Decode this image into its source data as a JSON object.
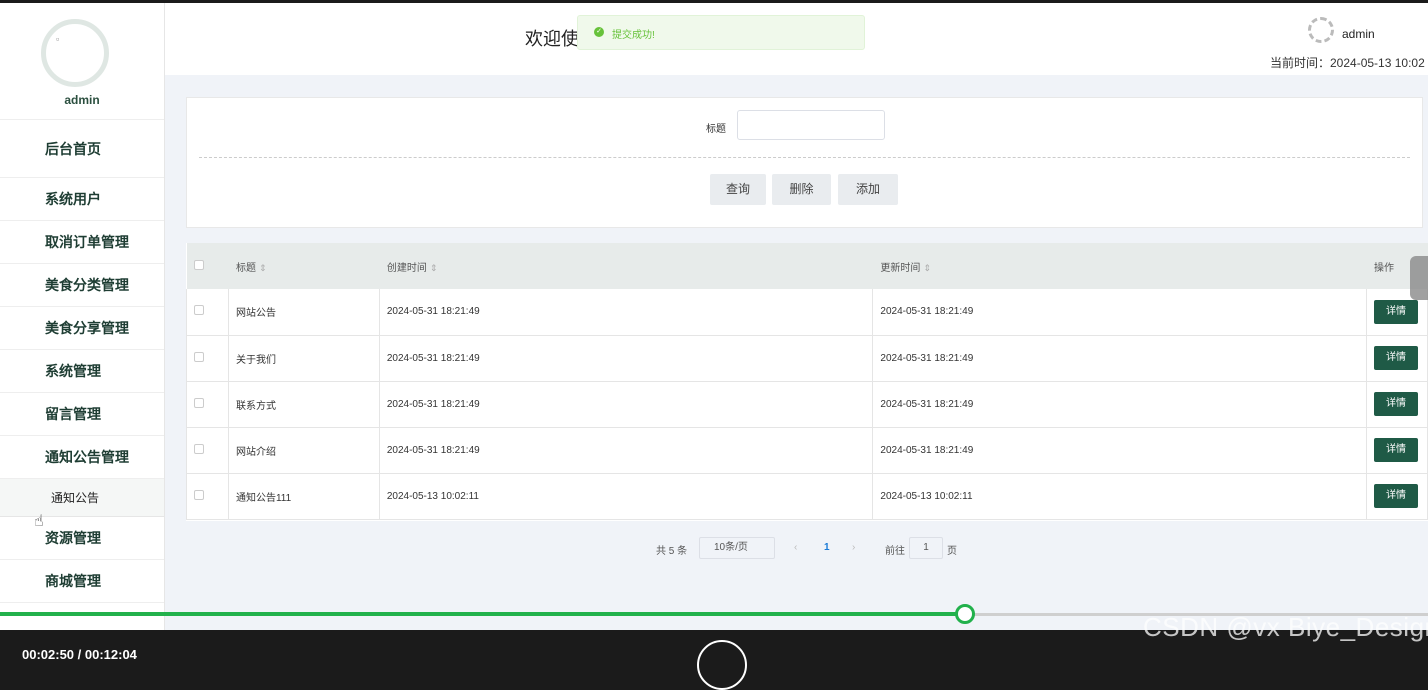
{
  "sidebar": {
    "username": "admin",
    "items": [
      {
        "label": "后台首页"
      },
      {
        "label": "系统用户"
      },
      {
        "label": "取消订单管理"
      },
      {
        "label": "美食分类管理"
      },
      {
        "label": "美食分享管理"
      },
      {
        "label": "系统管理"
      },
      {
        "label": "留言管理"
      },
      {
        "label": "通知公告管理"
      }
    ],
    "sub_item": "通知公告",
    "items_after": [
      {
        "label": "资源管理"
      },
      {
        "label": "商城管理"
      }
    ]
  },
  "header": {
    "welcome": "欢迎使",
    "username": "admin",
    "time_label": "当前时间：2024-05-13 10:02"
  },
  "toast": {
    "message": "提交成功!",
    "color": "#67c23a"
  },
  "search": {
    "title_label": "标题",
    "title_value": "",
    "query_button": "查询",
    "delete_button": "删除",
    "add_button": "添加"
  },
  "table": {
    "headers": [
      "标题",
      "创建时间",
      "更新时间",
      "操作"
    ],
    "rows": [
      {
        "title": "网站公告",
        "created": "2024-05-31 18:21:49",
        "updated": "2024-05-31 18:21:49",
        "action": "详情"
      },
      {
        "title": "关于我们",
        "created": "2024-05-31 18:21:49",
        "updated": "2024-05-31 18:21:49",
        "action": "详情"
      },
      {
        "title": "联系方式",
        "created": "2024-05-31 18:21:49",
        "updated": "2024-05-31 18:21:49",
        "action": "详情"
      },
      {
        "title": "网站介绍",
        "created": "2024-05-31 18:21:49",
        "updated": "2024-05-31 18:21:49",
        "action": "详情"
      },
      {
        "title": "通知公告111",
        "created": "2024-05-13 10:02:11",
        "updated": "2024-05-13 10:02:11",
        "action": "详情"
      }
    ]
  },
  "pagination": {
    "total": "共 5 条",
    "page_size": "10条/页",
    "prev": "‹",
    "current": "1",
    "next": "›",
    "goto_label": "前往",
    "goto_value": "1",
    "page_unit": "页"
  },
  "player": {
    "time": "00:02:50 / 00:12:04",
    "progress": 0.676,
    "watermark": "CSDN @vx Biye_Design",
    "accent": "#22b14c"
  },
  "colors": {
    "brand": "#1f5a46"
  }
}
